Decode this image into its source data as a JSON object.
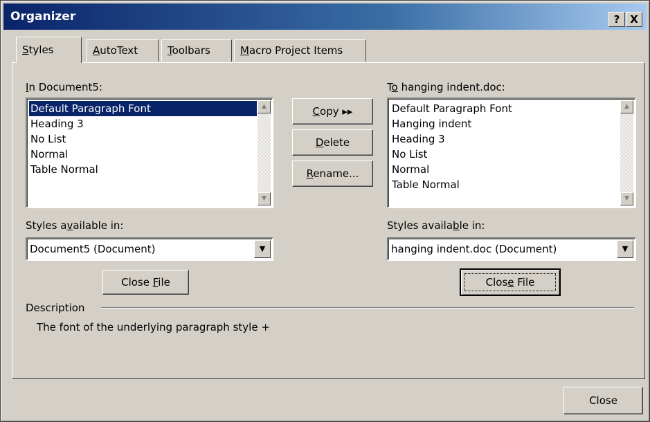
{
  "window": {
    "title": "Organizer",
    "help_glyph": "?",
    "close_glyph": "X"
  },
  "tabs": [
    {
      "prefix": "",
      "accel": "S",
      "rest": "tyles"
    },
    {
      "prefix": "",
      "accel": "A",
      "rest": "utoText"
    },
    {
      "prefix": "",
      "accel": "T",
      "rest": "oolbars"
    },
    {
      "prefix": "",
      "accel": "M",
      "rest": "acro Project Items"
    }
  ],
  "left": {
    "label_accel": "I",
    "label_rest": "n Document5:",
    "items": [
      "Default Paragraph Font",
      "Heading 3",
      "No List",
      "Normal",
      "Table Normal"
    ],
    "selected": "Default Paragraph Font",
    "available_pre": "Styles a",
    "available_accel": "v",
    "available_post": "ailable in:",
    "combo_value": "Document5 (Document)",
    "close_file_pre": "Close ",
    "close_file_accel": "F",
    "close_file_post": "ile"
  },
  "right": {
    "label_pre": "T",
    "label_accel": "o",
    "label_post": " hanging indent.doc:",
    "items": [
      "Default Paragraph Font",
      "Hanging indent",
      "Heading 3",
      "No List",
      "Normal",
      "Table Normal"
    ],
    "available_pre": "Styles availa",
    "available_accel": "b",
    "available_post": "le in:",
    "combo_value": "hanging indent.doc (Document)",
    "close_file_pre": "Clos",
    "close_file_accel": "e",
    "close_file_post": " File"
  },
  "middle": {
    "copy_accel": "C",
    "copy_rest": "opy",
    "copy_arrows": "▸▸",
    "delete_accel": "D",
    "delete_rest": "elete",
    "rename_accel": "R",
    "rename_rest": "ename..."
  },
  "description": {
    "label": "Description",
    "text": "The font of the underlying paragraph style +"
  },
  "footer": {
    "close_label": "Close"
  },
  "scroll_icons": {
    "up": "▲",
    "down": "▼",
    "combo": "▼"
  }
}
